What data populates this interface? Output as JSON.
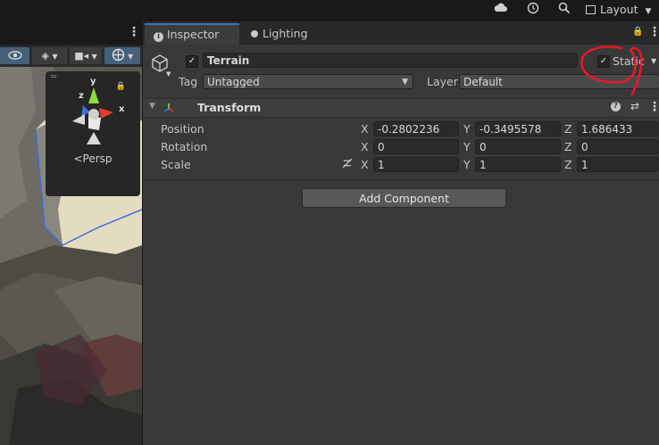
{
  "toolbar": {
    "cloud_icon": "cloud-icon",
    "history_icon": "history-icon",
    "search_icon": "search-icon",
    "layout_label": "Layout"
  },
  "scene": {
    "persp_label": "Persp",
    "gizmo_y": "y",
    "gizmo_z": "z",
    "gizmo_x": "x"
  },
  "inspector": {
    "tabs": [
      {
        "label": "Inspector",
        "icon": "info-icon",
        "active": true
      },
      {
        "label": "Lighting",
        "icon": "lightbulb-icon",
        "active": false
      }
    ],
    "object": {
      "active": true,
      "name": "Terrain",
      "static_label": "Static",
      "static_checked": true,
      "tag_label": "Tag",
      "tag_value": "Untagged",
      "layer_label": "Layer",
      "layer_value": "Default"
    },
    "transform": {
      "title": "Transform",
      "rows": [
        {
          "label": "Position",
          "x": "-0.2802236",
          "y": "-0.3495578",
          "z": "1.686433"
        },
        {
          "label": "Rotation",
          "x": "0",
          "y": "0",
          "z": "0"
        },
        {
          "label": "Scale",
          "x": "1",
          "y": "1",
          "z": "1"
        }
      ],
      "axis_x": "X",
      "axis_y": "Y",
      "axis_z": "Z"
    },
    "add_component_label": "Add Component"
  },
  "colors": {
    "accent_tab": "#3a79bb",
    "annotation_red": "#e8172a"
  }
}
